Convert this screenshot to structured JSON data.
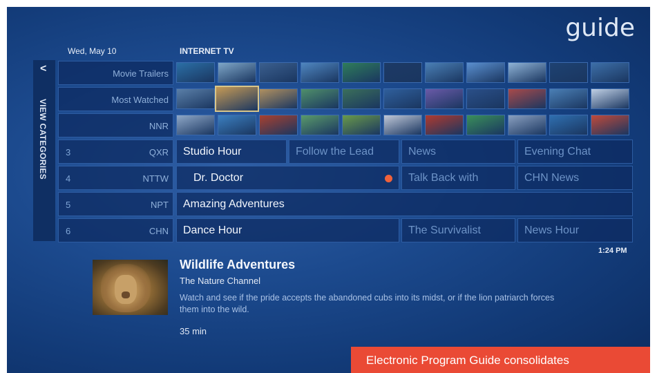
{
  "header": {
    "title": "guide",
    "date": "Wed, May 10",
    "section": "INTERNET TV"
  },
  "categories": {
    "arrow": "<",
    "label": "VIEW CATEGORIES"
  },
  "internet_rows": [
    {
      "name": "Movie Trailers"
    },
    {
      "name": "Most Watched"
    },
    {
      "name": "NNR"
    }
  ],
  "channels": [
    {
      "number": "3",
      "name": "QXR",
      "programs": [
        "Studio Hour",
        "Follow the Lead",
        "News",
        "Evening Chat"
      ]
    },
    {
      "number": "4",
      "name": "NTTW",
      "programs": [
        "Dr. Doctor",
        "Talk Back with",
        "CHN News"
      ]
    },
    {
      "number": "5",
      "name": "NPT",
      "programs": [
        "Amazing Adventures"
      ]
    },
    {
      "number": "6",
      "name": "CHN",
      "programs": [
        "Dance Hour",
        "The Survivalist",
        "News Hour"
      ]
    }
  ],
  "time": "1:24 PM",
  "detail": {
    "title": "Wildlife Adventures",
    "channel": "The Nature Channel",
    "description": "Watch and see if the pride accepts the abandoned cubs into its midst, or if the lion patriarch forces them into the wild.",
    "duration": "35 min"
  },
  "caption": "Electronic Program Guide consolidates",
  "colors": {
    "background": "#1c4a8e",
    "cell": "#0c2a5f",
    "record_dot": "#f0623b",
    "caption_banner": "#ea4a35"
  }
}
